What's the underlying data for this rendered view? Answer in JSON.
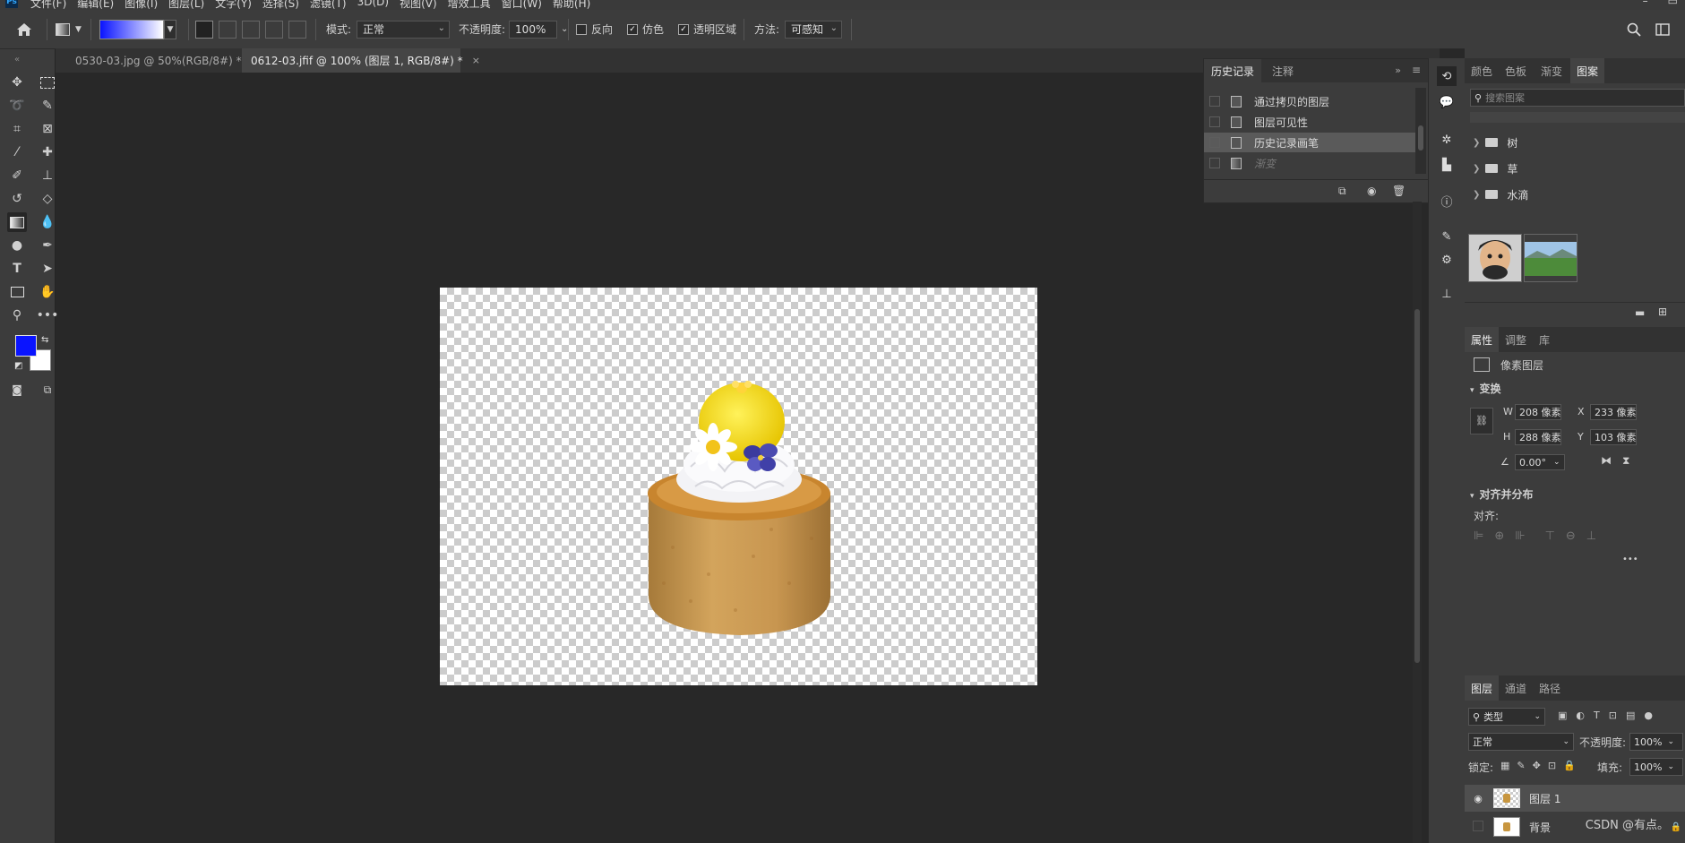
{
  "menubar": {
    "logo": "Ps",
    "items": [
      "文件(F)",
      "编辑(E)",
      "图像(I)",
      "图层(L)",
      "文字(Y)",
      "选择(S)",
      "滤镜(T)",
      "3D(D)",
      "视图(V)",
      "增效工具",
      "窗口(W)",
      "帮助(H)"
    ],
    "win_min": "–",
    "win_max": "▭"
  },
  "options": {
    "mode_label": "模式:",
    "mode_value": "正常",
    "opacity_label": "不透明度:",
    "opacity_value": "100%",
    "reverse_label": "反向",
    "dither_label": "仿色",
    "transparency_label": "透明区域",
    "method_label": "方法:",
    "method_value": "可感知",
    "gradient_colors": [
      "#0a14ff",
      "#ffffff"
    ]
  },
  "tabs": [
    {
      "label": "0530-03.jpg @ 50%(RGB/8#) *",
      "active": false
    },
    {
      "label": "0612-03.jfif @ 100% (图层 1, RGB/8#) *",
      "active": true
    }
  ],
  "colors": {
    "foreground": "#0a14ff",
    "background": "#ffffff"
  },
  "history": {
    "tabs": [
      "历史记录",
      "注释"
    ],
    "items": [
      {
        "label": "通过拷贝的图层"
      },
      {
        "label": "图层可见性"
      },
      {
        "label": "历史记录画笔",
        "selected": true
      },
      {
        "label": "渐变",
        "disabled": true
      }
    ]
  },
  "patterns_panel": {
    "tabs": [
      "颜色",
      "色板",
      "渐变",
      "图案"
    ],
    "search_placeholder": "搜索图案",
    "folders": [
      "树",
      "草",
      "水滴"
    ]
  },
  "properties": {
    "tabs": [
      "属性",
      "调整",
      "库"
    ],
    "layer_type": "像素图层",
    "transform_title": "变换",
    "w_label": "W",
    "w_value": "208 像素",
    "h_label": "H",
    "h_value": "288 像素",
    "x_label": "X",
    "x_value": "233 像素",
    "y_label": "Y",
    "y_value": "103 像素",
    "angle_value": "0.00°",
    "align_title": "对齐并分布",
    "align_label": "对齐:",
    "more": "•••"
  },
  "layers": {
    "tabs": [
      "图层",
      "通道",
      "路径"
    ],
    "filter_value": "类型",
    "blend_value": "正常",
    "opacity_label": "不透明度:",
    "opacity_value": "100%",
    "lock_label": "锁定:",
    "fill_label": "填充:",
    "fill_value": "100%",
    "items": [
      {
        "name": "图层 1",
        "visible": true,
        "active": true
      },
      {
        "name": "背景",
        "visible": false,
        "active": false
      }
    ]
  },
  "watermark": "CSDN @有点。"
}
